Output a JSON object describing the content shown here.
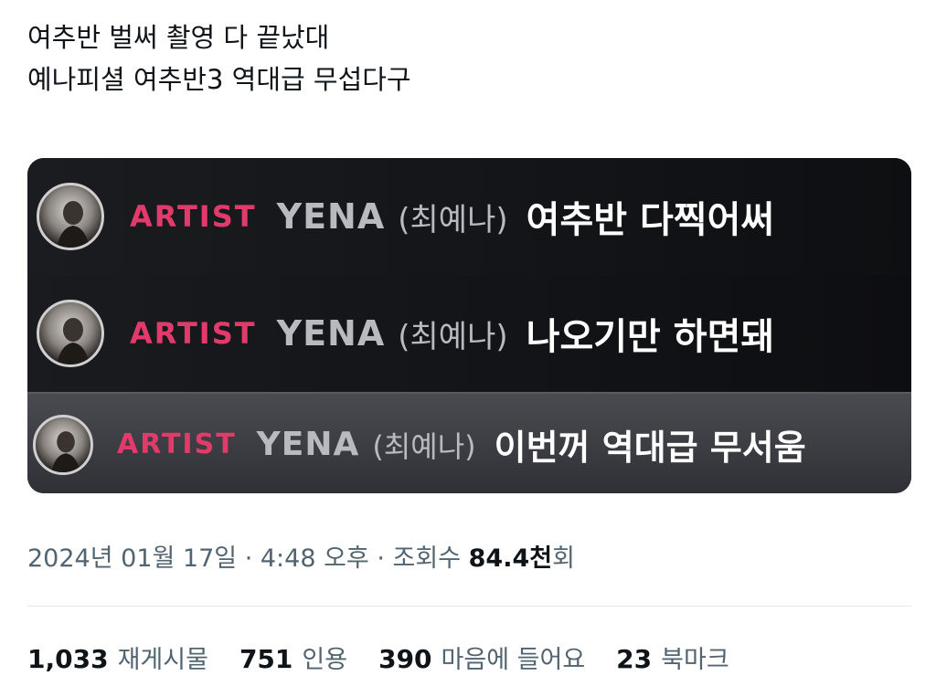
{
  "tweet": {
    "line1": "여추반 벌써 촬영 다 끝났대",
    "line2": "예나피셜 여추반3 역대급 무섭다구"
  },
  "media": {
    "messages": [
      {
        "role": "ARTIST",
        "name": "YENA",
        "korean_name": "(최예나)",
        "text": "여추반 다찍어써"
      },
      {
        "role": "ARTIST",
        "name": "YENA",
        "korean_name": "(최예나)",
        "text": "나오기만 하면돼"
      },
      {
        "role": "ARTIST",
        "name": "YENA",
        "korean_name": "(최예나)",
        "text": "이번꺼 역대급 무서움"
      }
    ]
  },
  "meta": {
    "date": "2024년 01월 17일",
    "sep1": " · ",
    "time": "4:48 오후",
    "sep2": " · ",
    "views_label": "조회수 ",
    "views_count": "84.4천",
    "views_suffix": "회"
  },
  "stats": {
    "reposts": {
      "num": "1,033",
      "label": "재게시물"
    },
    "quotes": {
      "num": "751",
      "label": "인용"
    },
    "likes": {
      "num": "390",
      "label": "마음에 들어요"
    },
    "bookmarks": {
      "num": "23",
      "label": "북마크"
    }
  },
  "colors": {
    "role": "#e23b6b",
    "name": "#b9bac0",
    "message": "#ffffff",
    "muted_text": "#536471"
  }
}
